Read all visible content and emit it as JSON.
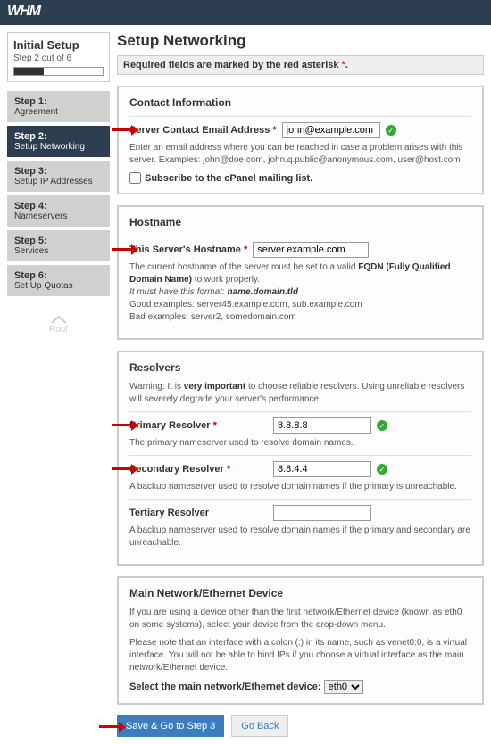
{
  "logo": "WHM",
  "sidebar": {
    "title": "Initial Setup",
    "subtitle": "Step 2 out of 6",
    "steps": [
      {
        "num": "Step 1:",
        "label": "Agreement"
      },
      {
        "num": "Step 2:",
        "label": "Setup Networking"
      },
      {
        "num": "Step 3:",
        "label": "Setup IP Addresses"
      },
      {
        "num": "Step 4:",
        "label": "Nameservers"
      },
      {
        "num": "Step 5:",
        "label": "Services"
      },
      {
        "num": "Step 6:",
        "label": "Set Up Quotas"
      }
    ]
  },
  "page": {
    "title": "Setup Networking",
    "required_msg": "Required fields are marked by the red asterisk ",
    "asterisk": "*"
  },
  "contact": {
    "heading": "Contact Information",
    "email_label": "Server Contact Email Address ",
    "email_value": "john@example.com",
    "email_desc": "Enter an email address where you can be reached in case a problem arises with this server. Examples: john@doe.com, john.q.public@anonymous.com, user@host.com",
    "subscribe_label": "Subscribe to the cPanel mailing list."
  },
  "hostname": {
    "heading": "Hostname",
    "label": "This Server's Hostname ",
    "value": "server.example.com",
    "desc1a": "The current hostname of the server must be set to a valid ",
    "desc1b": "FQDN (Fully Qualified Domain Name)",
    "desc1c": " to work properly.",
    "desc2a": "It must have this format: ",
    "desc2b": "name.domain.tld",
    "desc3": "Good examples: server45.example.com, sub.example.com",
    "desc4": "Bad examples: server2, somedomain.com"
  },
  "resolvers": {
    "heading": "Resolvers",
    "warn_a": "Warning: It is ",
    "warn_b": "very important",
    "warn_c": " to choose reliable resolvers. Using unreliable resolvers will severely degrade your server's performance.",
    "primary_label": "Primary Resolver ",
    "primary_value": "8.8.8.8",
    "primary_desc": "The primary nameserver used to resolve domain names.",
    "secondary_label": "Secondary Resolver ",
    "secondary_value": "8.8.4.4",
    "secondary_desc": "A backup nameserver used to resolve domain names if the primary is unreachable.",
    "tertiary_label": "Tertiary Resolver",
    "tertiary_value": "",
    "tertiary_desc": "A backup nameserver used to resolve domain names if the primary and secondary are unreachable."
  },
  "network": {
    "heading": "Main Network/Ethernet Device",
    "desc1": "If you are using a device other than the first network/Ethernet device (known as eth0 on some systems), select your device from the drop-down menu.",
    "desc2": "Please note that an interface with a colon (:) in its name, such as venet0:0, is a virtual interface. You will not be able to bind IPs if you choose a virtual interface as the main network/Ethernet device.",
    "select_label": "Select the main network/Ethernet device:",
    "select_value": "eth0"
  },
  "buttons": {
    "save": "Save & Go to Step 3",
    "back": "Go Back"
  },
  "watermark": "Roof"
}
